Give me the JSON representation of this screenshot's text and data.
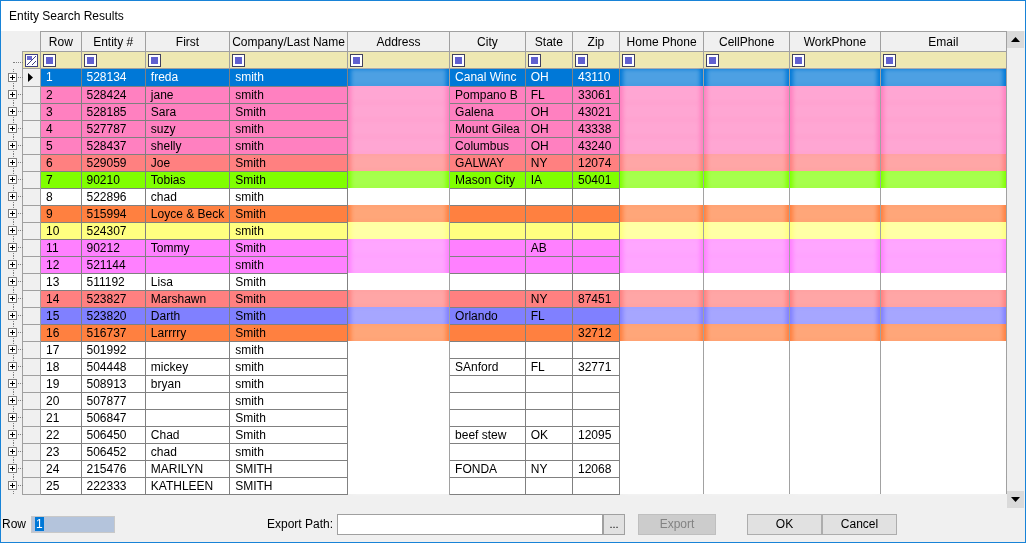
{
  "window": {
    "title": "Entity Search Results"
  },
  "table": {
    "columns": [
      {
        "label": "Row",
        "kind": "text"
      },
      {
        "label": "Entity #",
        "kind": "text"
      },
      {
        "label": "First",
        "kind": "text"
      },
      {
        "label": "Company/Last Name",
        "kind": "text"
      },
      {
        "label": "Address",
        "kind": "redacted"
      },
      {
        "label": "City",
        "kind": "text"
      },
      {
        "label": "State",
        "kind": "text"
      },
      {
        "label": "Zip",
        "kind": "text"
      },
      {
        "label": "Home Phone",
        "kind": "redacted"
      },
      {
        "label": "CellPhone",
        "kind": "redacted"
      },
      {
        "label": "WorkPhone",
        "kind": "redacted"
      },
      {
        "label": "Email",
        "kind": "redacted"
      }
    ],
    "rows": [
      {
        "selected": true,
        "cells": [
          "1",
          "528134",
          "freda",
          "smith",
          "",
          "Canal Winc",
          "OH",
          "43110",
          "",
          "",
          "",
          ""
        ]
      },
      {
        "selected": false,
        "color": "#ff80c0",
        "cells": [
          "2",
          "528424",
          "jane",
          "smith",
          "",
          "Pompano B",
          "FL",
          "33061",
          "",
          "",
          "",
          ""
        ]
      },
      {
        "selected": false,
        "color": "#ff80c0",
        "cells": [
          "3",
          "528185",
          "Sara",
          "Smith",
          "",
          "Galena",
          "OH",
          "43021",
          "",
          "",
          "",
          ""
        ]
      },
      {
        "selected": false,
        "color": "#ff80c0",
        "cells": [
          "4",
          "527787",
          "suzy",
          "smith",
          "",
          "Mount Gilea",
          "OH",
          "43338",
          "",
          "",
          "",
          ""
        ]
      },
      {
        "selected": false,
        "color": "#ff80c0",
        "cells": [
          "5",
          "528437",
          "shelly",
          "smith",
          "",
          "Columbus",
          "OH",
          "43240",
          "",
          "",
          "",
          ""
        ]
      },
      {
        "selected": false,
        "color": "#ff8080",
        "cells": [
          "6",
          "529059",
          "Joe",
          "Smith",
          "",
          "GALWAY",
          "NY",
          "12074",
          "",
          "",
          "",
          ""
        ]
      },
      {
        "selected": false,
        "color": "#80ff00",
        "cells": [
          "7",
          "90210",
          "Tobias",
          "Smith",
          "",
          "Mason City",
          "IA",
          "50401",
          "",
          "",
          "",
          ""
        ]
      },
      {
        "selected": false,
        "color": "#ffffff",
        "cells": [
          "8",
          "522896",
          "chad",
          "smith",
          "",
          "",
          "",
          "",
          "",
          "",
          "",
          ""
        ]
      },
      {
        "selected": false,
        "color": "#ff8040",
        "cells": [
          "9",
          "515994",
          "Loyce & Beck",
          "Smith",
          "",
          "",
          "",
          "",
          "",
          "",
          "",
          ""
        ]
      },
      {
        "selected": false,
        "color": "#ffff80",
        "cells": [
          "10",
          "524307",
          "",
          "smith",
          "",
          "",
          "",
          "",
          "",
          "",
          "",
          ""
        ]
      },
      {
        "selected": false,
        "color": "#ff80ff",
        "cells": [
          "11",
          "90212",
          "Tommy",
          "Smith",
          "",
          "",
          "AB",
          "",
          "",
          "",
          "",
          ""
        ]
      },
      {
        "selected": false,
        "color": "#ff80ff",
        "cells": [
          "12",
          "521144",
          "",
          "smith",
          "",
          "",
          "",
          "",
          "",
          "",
          "",
          ""
        ]
      },
      {
        "selected": false,
        "color": "#ffffff",
        "cells": [
          "13",
          "511192",
          "Lisa",
          "Smith",
          "",
          "",
          "",
          "",
          "",
          "",
          "",
          ""
        ]
      },
      {
        "selected": false,
        "color": "#ff8080",
        "cells": [
          "14",
          "523827",
          "Marshawn",
          "Smith",
          "",
          "",
          "NY",
          "87451",
          "",
          "",
          "",
          ""
        ]
      },
      {
        "selected": false,
        "color": "#8080ff",
        "cells": [
          "15",
          "523820",
          "Darth",
          "Smith",
          "",
          "Orlando",
          "FL",
          "",
          "",
          "",
          "",
          ""
        ]
      },
      {
        "selected": false,
        "color": "#ff8040",
        "cells": [
          "16",
          "516737",
          "Larrrry",
          "Smith",
          "",
          "",
          "",
          "32712",
          "",
          "",
          "",
          ""
        ]
      },
      {
        "selected": false,
        "color": "#ffffff",
        "cells": [
          "17",
          "501992",
          "",
          "smith",
          "",
          "",
          "",
          "",
          "",
          "",
          "",
          ""
        ]
      },
      {
        "selected": false,
        "color": "#ffffff",
        "cells": [
          "18",
          "504448",
          "mickey",
          "smith",
          "",
          "SAnford",
          "FL",
          "32771",
          "",
          "",
          "",
          ""
        ]
      },
      {
        "selected": false,
        "color": "#ffffff",
        "cells": [
          "19",
          "508913",
          "bryan",
          "smith",
          "",
          "",
          "",
          "",
          "",
          "",
          "",
          ""
        ]
      },
      {
        "selected": false,
        "color": "#ffffff",
        "cells": [
          "20",
          "507877",
          "",
          "smith",
          "",
          "",
          "",
          "",
          "",
          "",
          "",
          ""
        ]
      },
      {
        "selected": false,
        "color": "#ffffff",
        "cells": [
          "21",
          "506847",
          "",
          "Smith",
          "",
          "",
          "",
          "",
          "",
          "",
          "",
          ""
        ]
      },
      {
        "selected": false,
        "color": "#ffffff",
        "cells": [
          "22",
          "506450",
          "Chad",
          "Smith",
          "",
          "beef stew",
          "OK",
          "12095",
          "",
          "",
          "",
          ""
        ]
      },
      {
        "selected": false,
        "color": "#ffffff",
        "cells": [
          "23",
          "506452",
          "chad",
          "smith",
          "",
          "",
          "",
          "",
          "",
          "",
          "",
          ""
        ]
      },
      {
        "selected": false,
        "color": "#ffffff",
        "cells": [
          "24",
          "215476",
          "MARILYN",
          "SMITH",
          "",
          "FONDA",
          "NY",
          "12068",
          "",
          "",
          "",
          ""
        ]
      },
      {
        "selected": false,
        "color": "#ffffff",
        "cells": [
          "25",
          "222333",
          "KATHLEEN",
          "SMITH",
          "",
          "",
          "",
          "",
          "",
          "",
          "",
          ""
        ]
      }
    ]
  },
  "footer": {
    "row_label": "Row",
    "row_value": "1",
    "export_label": "Export Path:",
    "browse": "...",
    "buttons": [
      {
        "label": "Export",
        "disabled": true
      },
      {
        "label": "OK",
        "disabled": false
      },
      {
        "label": "Cancel",
        "disabled": false
      }
    ]
  }
}
